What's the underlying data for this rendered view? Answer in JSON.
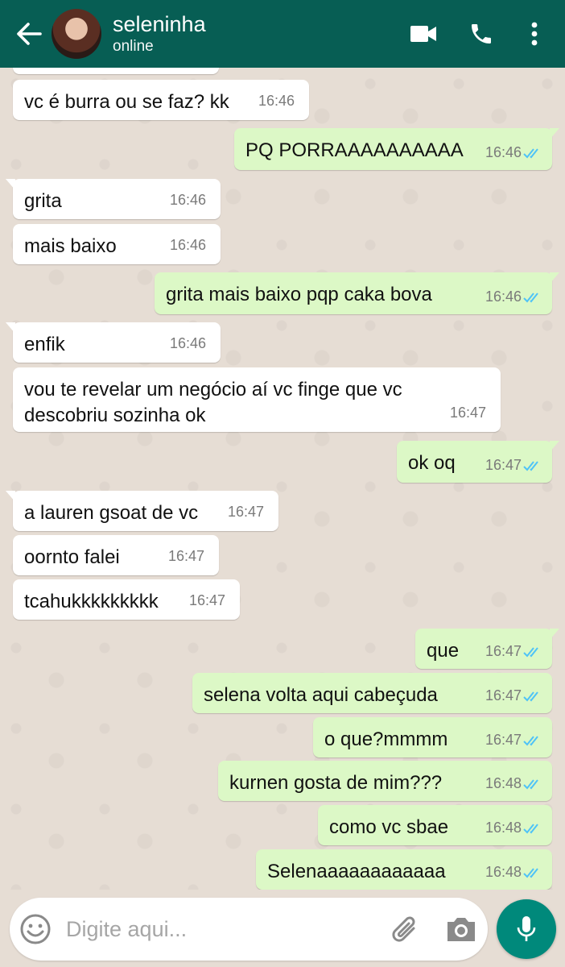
{
  "header": {
    "contact_name": "seleninha",
    "status": "online",
    "icons": [
      "back-arrow-icon",
      "video-call-icon",
      "phone-icon",
      "more-vert-icon"
    ]
  },
  "messages": [
    {
      "dir": "in",
      "text": "vc é burra ou se faz? kk",
      "time": "16:46"
    },
    {
      "dir": "out",
      "text": "PQ PORRAAAAAAAAAA",
      "time": "16:46",
      "read": true
    },
    {
      "dir": "in",
      "text": "grita",
      "time": "16:46"
    },
    {
      "dir": "in",
      "text": "mais baixo",
      "time": "16:46"
    },
    {
      "dir": "out",
      "text": "grita mais baixo pqp caka bova",
      "time": "16:46",
      "read": true
    },
    {
      "dir": "in",
      "text": "enfik",
      "time": "16:46"
    },
    {
      "dir": "in",
      "text": "vou te revelar um negócio aí vc finge que vc\ndescobriu sozinha ok",
      "time": "16:47"
    },
    {
      "dir": "out",
      "text": "ok oq",
      "time": "16:47",
      "read": true
    },
    {
      "dir": "in",
      "text": "a lauren gsoat de vc",
      "time": "16:47"
    },
    {
      "dir": "in",
      "text": "oornto falei",
      "time": "16:47"
    },
    {
      "dir": "in",
      "text": "tcahukkkkkkkkk",
      "time": "16:47"
    },
    {
      "dir": "out",
      "text": "que",
      "time": "16:47",
      "read": true
    },
    {
      "dir": "out",
      "text": "selena volta aqui cabeçuda",
      "time": "16:47",
      "read": true
    },
    {
      "dir": "out",
      "text": "o que?mmmm",
      "time": "16:47",
      "read": true
    },
    {
      "dir": "out",
      "text": "kurnen gosta de mim???",
      "time": "16:48",
      "read": true
    },
    {
      "dir": "out",
      "text": "como vc sbae",
      "time": "16:48",
      "read": true
    },
    {
      "dir": "out",
      "text": "Selenaaaaaaaaaaaa",
      "time": "16:48",
      "read": true
    }
  ],
  "input": {
    "placeholder": "Digite aqui...",
    "icons": [
      "emoji-icon",
      "attach-icon",
      "camera-icon",
      "mic-icon"
    ]
  },
  "colors": {
    "header": "#075e54",
    "outgoing_bubble": "#dcf8c6",
    "incoming_bubble": "#ffffff",
    "read_ticks": "#4fc3f7",
    "chat_background": "#e6ddd4",
    "mic_button": "#00897b"
  }
}
